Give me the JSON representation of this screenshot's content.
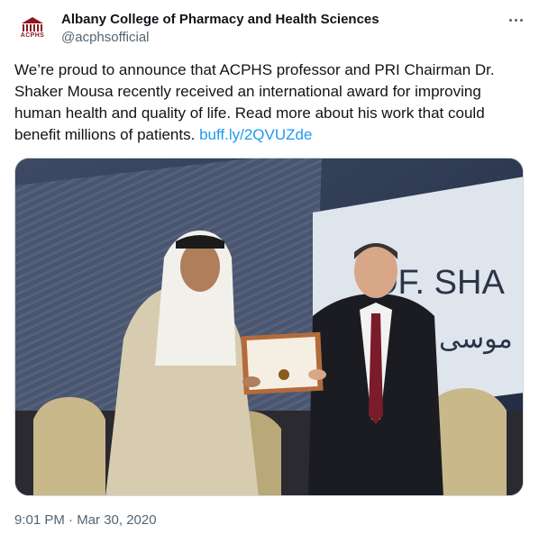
{
  "account": {
    "display_name": "Albany College of Pharmacy and Health Sciences",
    "handle": "@acphsofficial",
    "avatar_text": "ACPHS"
  },
  "tweet": {
    "text": "We’re proud to announce that ACPHS professor and PRI Chairman Dr. Shaker Mousa recently received an international award for improving human health and quality of life. Read more about his work that could benefit millions of patients.",
    "link_text": "buff.ly/2QVUZde"
  },
  "media": {
    "banner_text": "OF. SHA",
    "banner_arabic": "موسى"
  },
  "meta": {
    "timestamp": "9:01 PM · Mar 30, 2020"
  },
  "colors": {
    "link": "#1d9bf0",
    "secondary_text": "#536471",
    "brand": "#8a1a22"
  },
  "icons": {
    "more": "more-horizontal-icon"
  }
}
